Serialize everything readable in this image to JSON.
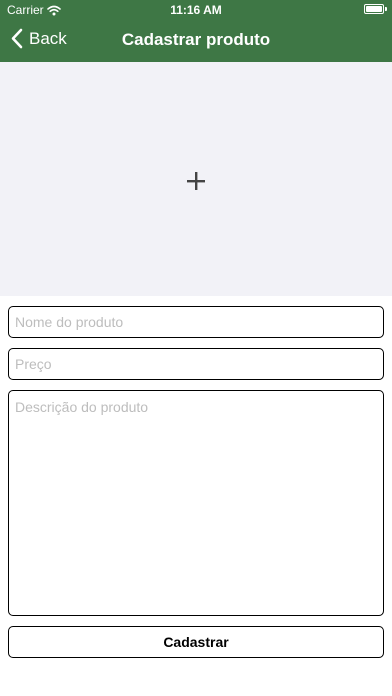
{
  "status_bar": {
    "carrier": "Carrier",
    "time": "11:16 AM",
    "wifi_icon": "wifi-icon",
    "battery_icon": "battery-icon"
  },
  "nav": {
    "back_label": "Back",
    "back_icon": "chevron-left-icon",
    "title": "Cadastrar produto"
  },
  "image_picker": {
    "icon": "plus-icon"
  },
  "form": {
    "name_placeholder": "Nome do produto",
    "name_value": "",
    "price_placeholder": "Preço",
    "price_value": "",
    "description_placeholder": "Descrição do produto",
    "description_value": "",
    "submit_label": "Cadastrar"
  },
  "colors": {
    "header_green": "#3e7745",
    "image_area_bg": "#f2f2f7",
    "placeholder_gray": "#bdbdbd"
  }
}
